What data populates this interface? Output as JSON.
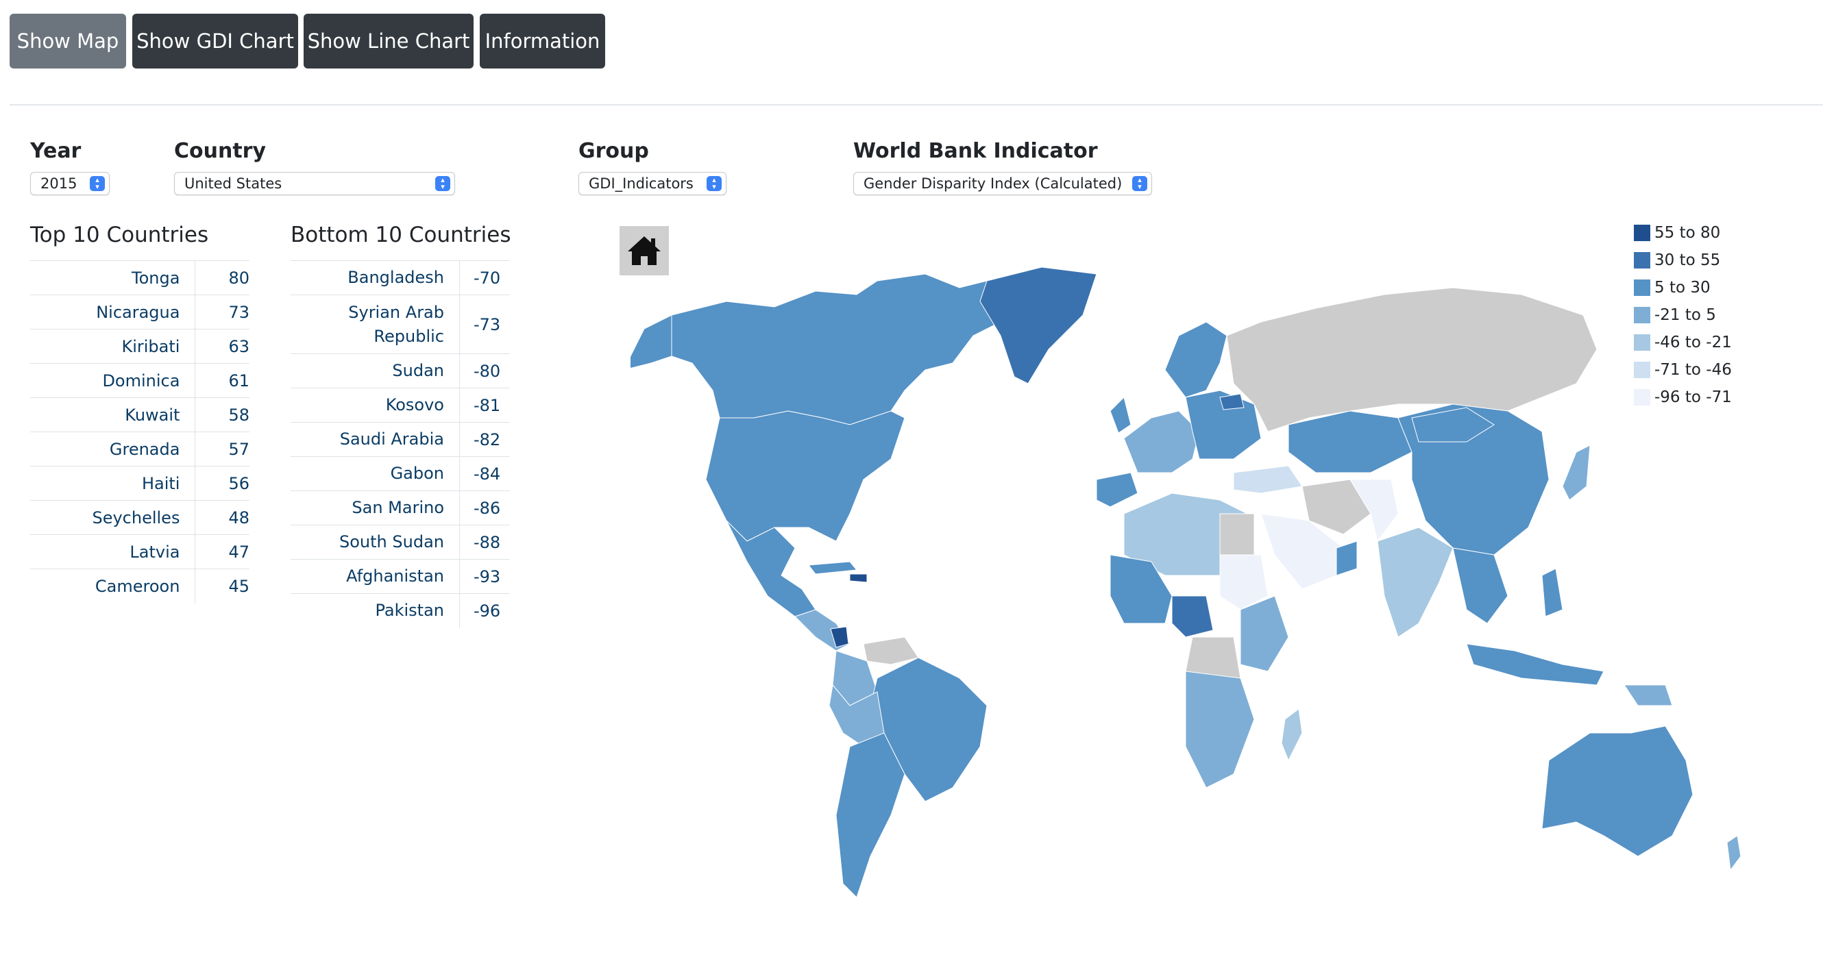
{
  "buttons": {
    "show_map": "Show Map",
    "show_gdi_chart": "Show GDI Chart",
    "show_line_chart": "Show Line Chart",
    "information": "Information"
  },
  "filters": {
    "year": {
      "label": "Year",
      "value": "2015"
    },
    "country": {
      "label": "Country",
      "value": "United States"
    },
    "group": {
      "label": "Group",
      "value": "GDI_Indicators"
    },
    "indicator": {
      "label": "World Bank Indicator",
      "value": "Gender Disparity Index (Calculated)"
    }
  },
  "top10": {
    "title": "Top 10 Countries",
    "rows": [
      {
        "country": "Tonga",
        "value": "80"
      },
      {
        "country": "Nicaragua",
        "value": "73"
      },
      {
        "country": "Kiribati",
        "value": "63"
      },
      {
        "country": "Dominica",
        "value": "61"
      },
      {
        "country": "Kuwait",
        "value": "58"
      },
      {
        "country": "Grenada",
        "value": "57"
      },
      {
        "country": "Haiti",
        "value": "56"
      },
      {
        "country": "Seychelles",
        "value": "48"
      },
      {
        "country": "Latvia",
        "value": "47"
      },
      {
        "country": "Cameroon",
        "value": "45"
      }
    ]
  },
  "bottom10": {
    "title": "Bottom 10 Countries",
    "rows": [
      {
        "country": "Bangladesh",
        "value": "-70"
      },
      {
        "country": "Syrian Arab Republic",
        "value": "-73"
      },
      {
        "country": "Sudan",
        "value": "-80"
      },
      {
        "country": "Kosovo",
        "value": "-81"
      },
      {
        "country": "Saudi Arabia",
        "value": "-82"
      },
      {
        "country": "Gabon",
        "value": "-84"
      },
      {
        "country": "San Marino",
        "value": "-86"
      },
      {
        "country": "South Sudan",
        "value": "-88"
      },
      {
        "country": "Afghanistan",
        "value": "-93"
      },
      {
        "country": "Pakistan",
        "value": "-96"
      }
    ]
  },
  "map": {
    "home_icon": "home-icon",
    "no_data_color": "#cccccc"
  },
  "legend": [
    {
      "label": "55 to 80",
      "color": "#1f4e8f"
    },
    {
      "label": "30 to 55",
      "color": "#3a72b0"
    },
    {
      "label": "5 to 30",
      "color": "#5592c6"
    },
    {
      "label": "-21 to 5",
      "color": "#7eaed6"
    },
    {
      "label": "-46 to -21",
      "color": "#a6c8e2"
    },
    {
      "label": "-71 to -46",
      "color": "#cddff0"
    },
    {
      "label": "-96 to -71",
      "color": "#eef2fb"
    }
  ]
}
